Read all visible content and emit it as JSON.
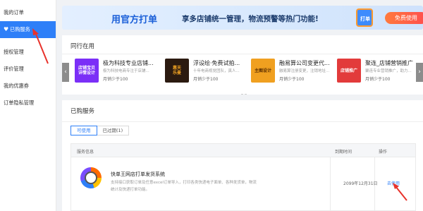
{
  "sidebar": {
    "items": [
      {
        "label": "我的订单"
      },
      {
        "label": "已购服务"
      },
      {
        "label": "授权管理"
      },
      {
        "label": "评价管理"
      },
      {
        "label": "我的优惠券"
      },
      {
        "label": "订单隐私管理"
      }
    ],
    "active_icon": "♥"
  },
  "banner": {
    "title": "用官方打单",
    "subtitle": "享多店铺统一管理，物流预警等热门功能!",
    "bag_text": "打单",
    "button_label": "免费使用"
  },
  "peers": {
    "title": "同行在用",
    "left_arrow": "‹",
    "right_arrow": "›",
    "cards": [
      {
        "thumb_text": "店铺宝贝\n详情设计",
        "name": "极为科技专业店铺...",
        "desc": "极为科技电商专注于店铺...",
        "price": "月销少于100",
        "bg": "#7b2ff7",
        "fg": "#fff"
      },
      {
        "thumb_text": "惠天\n乐曼",
        "name": "浮设绘·免费试拍...",
        "desc": "十年电商视觉团队，真人...",
        "price": "月销少于100",
        "bg": "#2b1a10",
        "fg": "#f5a623"
      },
      {
        "thumb_text": "主图设计",
        "name": "融易算公司变更代...",
        "desc": "融易算注册变更，注销地址...",
        "price": "月销少于100",
        "bg": "#f0a020",
        "fg": "#5a2d00"
      },
      {
        "thumb_text": "店铺推广",
        "name": "聚连_店铺营销推广",
        "desc": "聚连专业营销推广，助力...",
        "price": "月销少于100",
        "bg": "#e23b3b",
        "fg": "#fff"
      }
    ]
  },
  "services": {
    "title": "已购服务",
    "tabs": [
      {
        "label": "可使用"
      },
      {
        "label": "已过期(1)"
      }
    ],
    "headers": {
      "info": "服务信息",
      "expire": "到期时间",
      "action": "操作"
    },
    "rows": [
      {
        "name": "快单王网店打单发货系统",
        "desc": "支持接口获取订单及任意excel订单导入，打印各类快递电子面单、各种发货单，物流统计及快递打单功能。",
        "expire": "2099年12月31日",
        "action": "去使用"
      }
    ]
  },
  "colors": {
    "accent": "#2e7ff8",
    "annotation_arrow": "#e8322b"
  }
}
